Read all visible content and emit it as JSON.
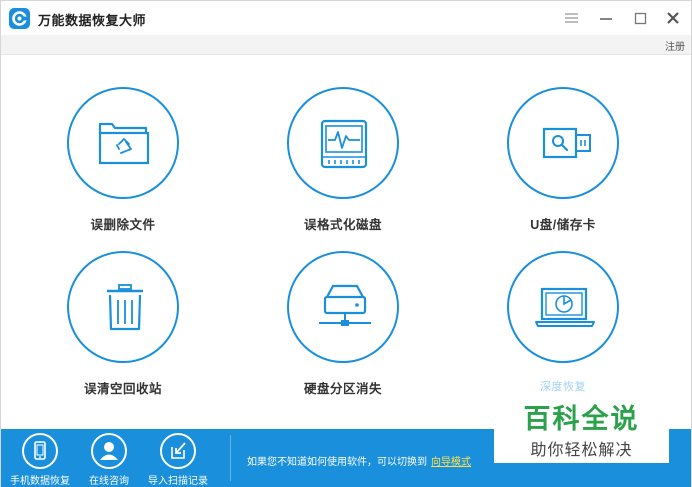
{
  "app": {
    "title": "万能数据恢复大师"
  },
  "window_controls": {
    "menu_icon": "menu-icon",
    "minimize_icon": "minimize-icon",
    "maximize_icon": "maximize-icon",
    "close_icon": "close-icon"
  },
  "subbar": {
    "register_label": "注册"
  },
  "tiles": [
    {
      "label": "误删除文件",
      "icon": "recycle-folder-icon"
    },
    {
      "label": "误格式化磁盘",
      "icon": "disk-pulse-icon"
    },
    {
      "label": "U盘/储存卡",
      "icon": "usb-drive-icon"
    },
    {
      "label": "误清空回收站",
      "icon": "trash-bin-icon"
    },
    {
      "label": "硬盘分区消失",
      "icon": "network-drive-icon"
    },
    {
      "label": "深度恢复",
      "icon": "laptop-scan-icon"
    }
  ],
  "bottom_bar": {
    "items": [
      {
        "label": "手机数据恢复",
        "icon": "phone-icon"
      },
      {
        "label": "在线咨询",
        "icon": "person-icon"
      },
      {
        "label": "导入扫描记录",
        "icon": "import-icon"
      }
    ],
    "tip_text": "如果您不知道如何使用软件，可以切换到",
    "guide_link": "向导模式"
  },
  "watermark": {
    "title": "百科全说",
    "subtitle": "助你轻松解决"
  },
  "colors": {
    "accent": "#1a8fdc",
    "link": "#ffe14d",
    "watermark_green": "#2aa14a"
  }
}
